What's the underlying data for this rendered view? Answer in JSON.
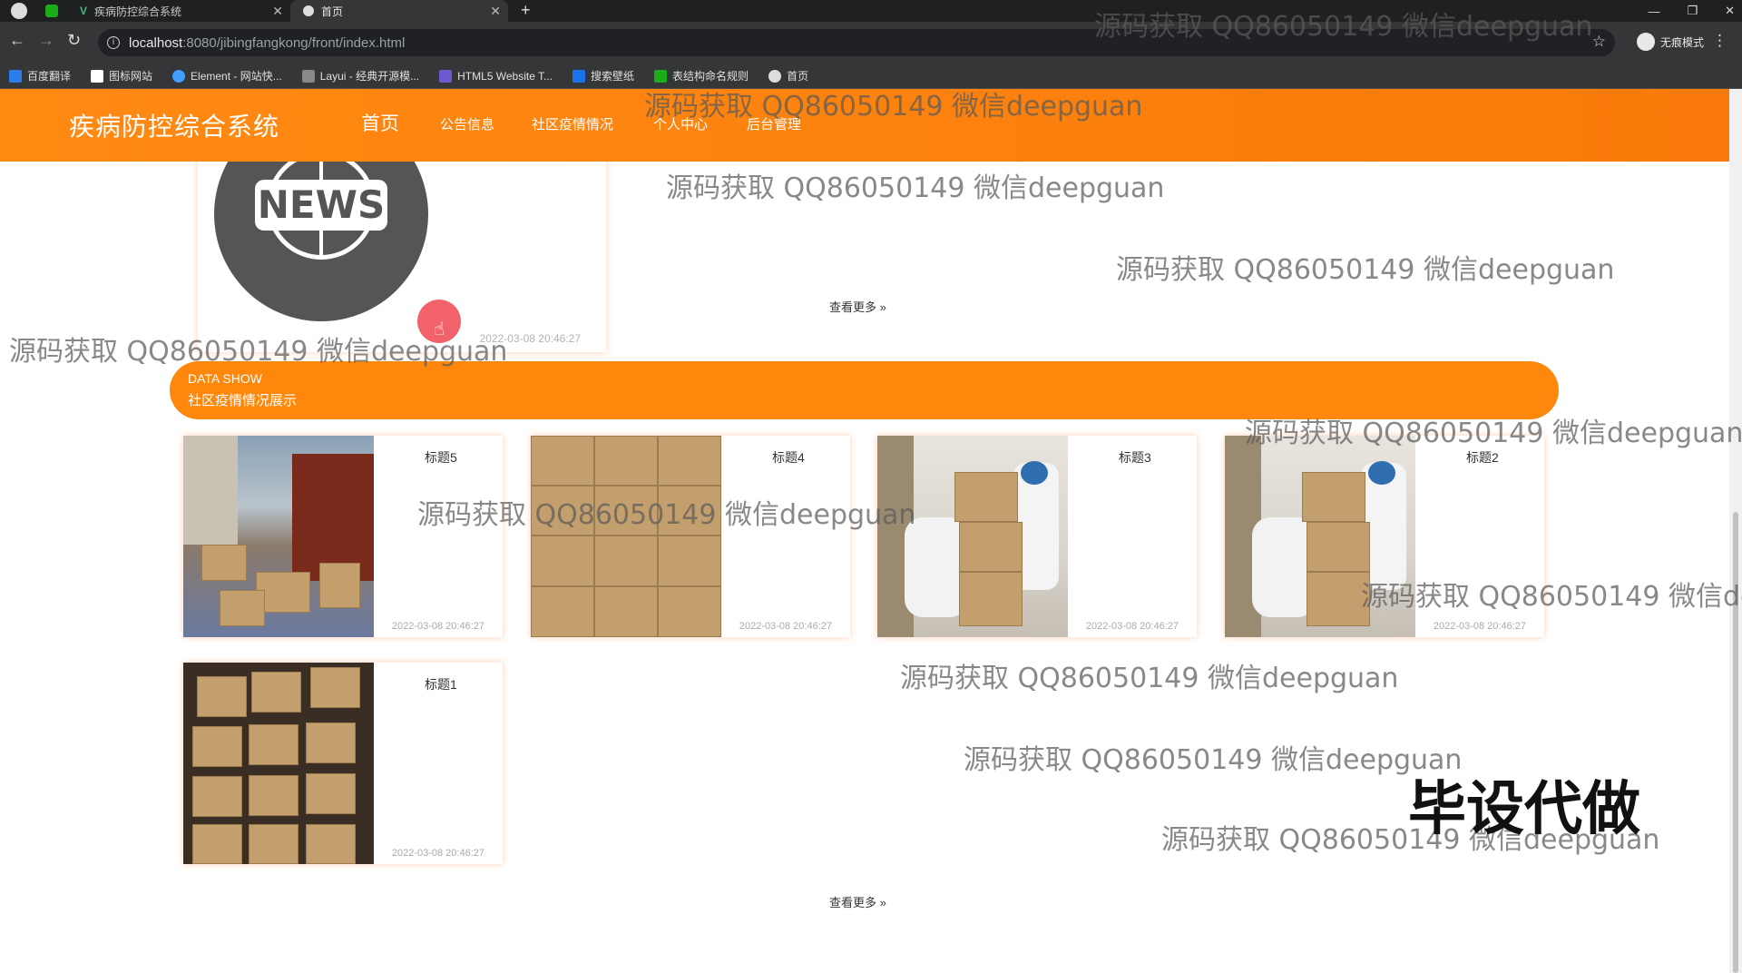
{
  "browser": {
    "tabs": [
      {
        "title": "疾病防控综合系统"
      },
      {
        "title": "首页"
      }
    ],
    "url_host": "localhost",
    "url_path": ":8080/jibingfangkong/front/index.html",
    "profile_label": "无痕模式",
    "bookmarks": [
      {
        "label": "百度翻译",
        "color": "#2b7de9"
      },
      {
        "label": "图标网站",
        "color": "#ffffff"
      },
      {
        "label": "Element - 网站快...",
        "color": "#409eff"
      },
      {
        "label": "Layui - 经典开源模...",
        "color": "#cccccc"
      },
      {
        "label": "HTML5 Website T...",
        "color": "#6a5acd"
      },
      {
        "label": "搜索壁纸",
        "color": "#1a73e8"
      },
      {
        "label": "表结构命名规则",
        "color": "#1aad19"
      },
      {
        "label": "首页",
        "color": "#dddddd"
      }
    ]
  },
  "site": {
    "title": "疾病防控综合系统",
    "nav": [
      "首页",
      "公告信息",
      "社区疫情情况",
      "个人中心",
      "后台管理"
    ],
    "accent_color": "#ff870c"
  },
  "news": {
    "image_label": "NEWS",
    "date": "2022-03-08 20:46:27",
    "more_label": "查看更多 »"
  },
  "section": {
    "title_en": "DATA SHOW",
    "title_cn": "社区疫情情况展示",
    "more_label": "查看更多 »",
    "cards": [
      {
        "title": "标题5",
        "date": "2022-03-08 20:46:27"
      },
      {
        "title": "标题4",
        "date": "2022-03-08 20:46:27"
      },
      {
        "title": "标题3",
        "date": "2022-03-08 20:46:27"
      },
      {
        "title": "标题2",
        "date": "2022-03-08 20:46:27"
      },
      {
        "title": "标题1",
        "date": "2022-03-08 20:46:27"
      }
    ]
  },
  "watermarks": {
    "text": "源码获取 QQ86050149 微信deepguan",
    "partial": "源码获取 QQ86050149 微信de",
    "big": "毕设代做"
  }
}
